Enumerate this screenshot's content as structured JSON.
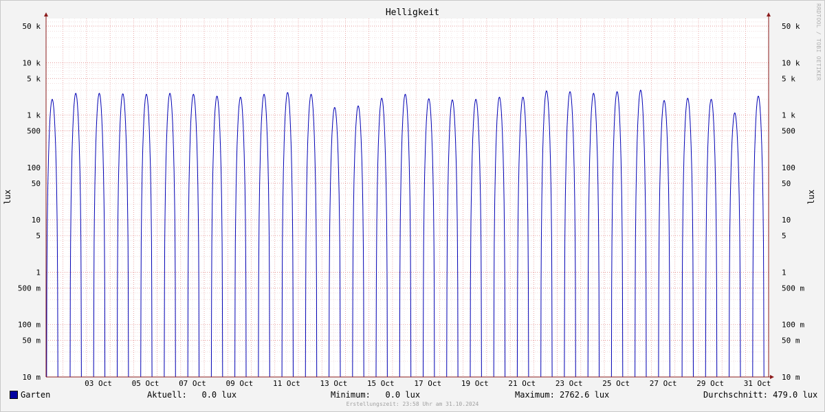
{
  "chart_data": {
    "type": "line",
    "title": "Helligkeit",
    "ylabel": "lux",
    "yscale": "log",
    "ylim": [
      10,
      60000
    ],
    "unit": "lux",
    "x_tick_labels": [
      "03 Oct",
      "05 Oct",
      "07 Oct",
      "09 Oct",
      "11 Oct",
      "13 Oct",
      "15 Oct",
      "17 Oct",
      "19 Oct",
      "21 Oct",
      "23 Oct",
      "25 Oct",
      "27 Oct",
      "29 Oct",
      "31 Oct"
    ],
    "y_tick_labels": [
      "50 k",
      "10 k",
      "5 k",
      "1 k",
      "500",
      "100",
      "50",
      "10",
      "5",
      "1",
      "500 m",
      "100 m",
      "50 m",
      "10 m"
    ],
    "y_tick_values": [
      50000,
      10000,
      5000,
      1000,
      500,
      100,
      50,
      10,
      5,
      1,
      0.5,
      0.1,
      0.05,
      0.01
    ],
    "grid": true,
    "series": [
      {
        "name": "Garten",
        "color": "#0000b4",
        "x_start": "2024-10-01",
        "x_end": "2024-10-31",
        "daily_max_lux": [
          2000,
          2600,
          2600,
          2550,
          2500,
          2600,
          2500,
          2300,
          2200,
          2500,
          2700,
          2500,
          1400,
          1500,
          2100,
          2500,
          2050,
          1950,
          2000,
          2200,
          2200,
          2900,
          2800,
          2600,
          2800,
          3000,
          1900,
          2100,
          2000,
          1100,
          2300
        ]
      }
    ]
  },
  "legend": {
    "series_name": "Garten",
    "aktuell": "Aktuell:   0.0 lux",
    "minimum": "Minimum:   0.0 lux",
    "maximum": "Maximum: 2762.6 lux",
    "durchschnitt": "Durchschnitt: 479.0 lux"
  },
  "footer": "Erstellungszeit: 23:58 Uhr am 31.10.2024",
  "credit": "RRDTOOL / TOBI OETIKER"
}
